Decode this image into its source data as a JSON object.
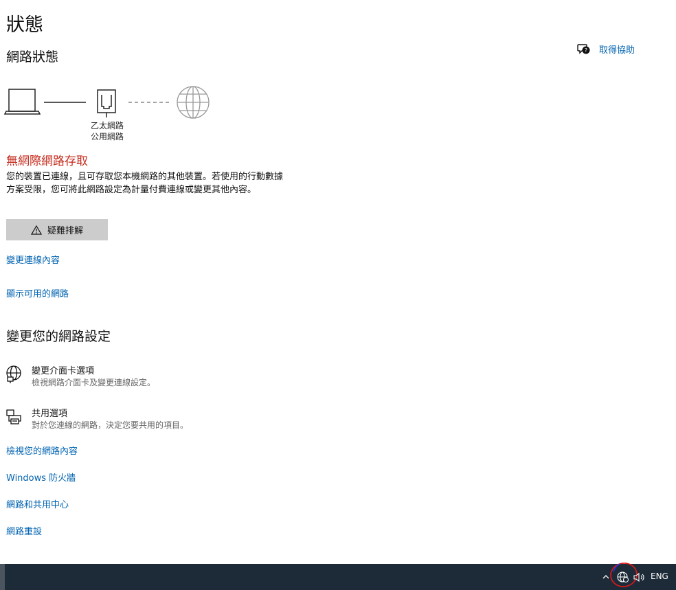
{
  "page": {
    "title": "狀態"
  },
  "status": {
    "section_title": "網路狀態",
    "adapter_type": "乙太網路",
    "network_profile": "公用網路",
    "error_title": "無網際網路存取",
    "description": "您的裝置已連線，且可存取您本機網路的其他裝置。若使用的行動數據方案受限，您可將此網路設定為計量付費連線或變更其他內容。",
    "troubleshoot_label": "疑難排解",
    "links": {
      "change_properties": "變更連線內容",
      "show_networks": "顯示可用的網路"
    }
  },
  "help": {
    "label": "取得協助"
  },
  "settings": {
    "section_title": "變更您的網路設定",
    "options": [
      {
        "title": "變更介面卡選項",
        "desc": "檢視網路介面卡及變更連線設定。",
        "icon": "adapter-globe-icon"
      },
      {
        "title": "共用選項",
        "desc": "對於您連線的網路，決定您要共用的項目。",
        "icon": "sharing-printer-icon"
      }
    ],
    "links": {
      "view_properties": "檢視您的網路內容",
      "firewall": "Windows 防火牆",
      "sharing_center": "網路和共用中心",
      "reset": "網路重設"
    }
  },
  "taskbar": {
    "language": "ENG"
  },
  "colors": {
    "accent": "#0063b1",
    "error": "#c42b1c",
    "taskbar": "#1d2b38",
    "button": "#cccccc"
  }
}
